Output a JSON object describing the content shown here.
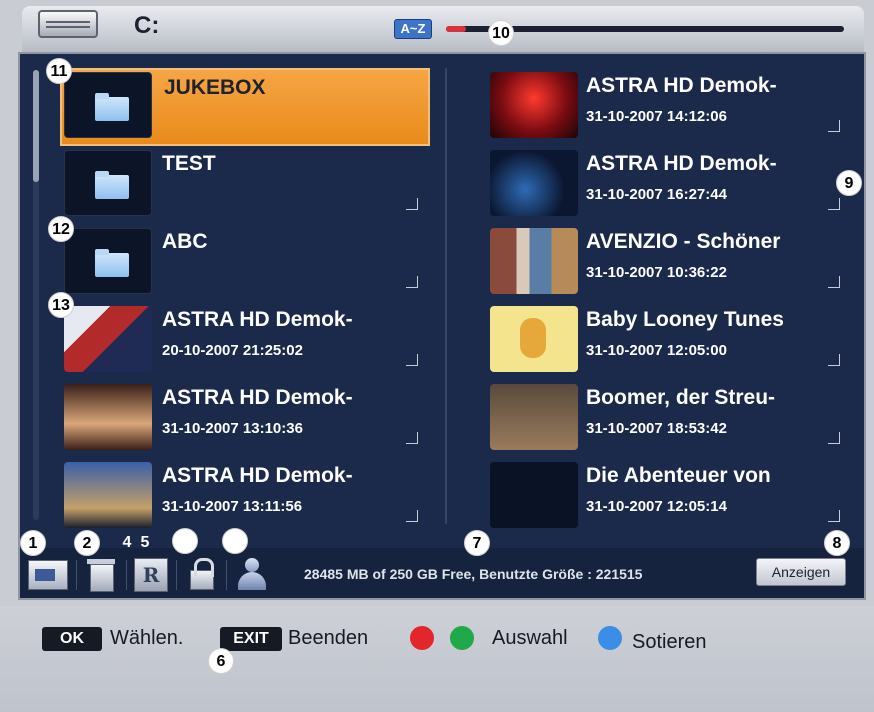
{
  "header": {
    "drive_label": "C:",
    "sort_badge": "A~Z",
    "progress_fraction": 0.05,
    "colors": {
      "progress": "#d9343a",
      "badge": "#3d74c7"
    }
  },
  "left_list": [
    {
      "title": "JUKEBOX",
      "date": "",
      "type": "folder",
      "selected": true,
      "checkbox": false
    },
    {
      "title": "TEST",
      "date": "",
      "type": "folder",
      "selected": false,
      "checkbox": true
    },
    {
      "title": "ABC",
      "date": "",
      "type": "folder",
      "selected": false,
      "checkbox": true
    },
    {
      "title": "ASTRA HD Demok-",
      "date": "20-10-2007 21:25:02",
      "type": "video",
      "selected": false,
      "checkbox": true
    },
    {
      "title": "ASTRA HD Demok-",
      "date": "31-10-2007 13:10:36",
      "type": "video",
      "selected": false,
      "checkbox": true
    },
    {
      "title": "ASTRA HD Demok-",
      "date": "31-10-2007 13:11:56",
      "type": "video",
      "selected": false,
      "checkbox": true
    }
  ],
  "right_list": [
    {
      "title": "ASTRA HD Demok-",
      "date": "31-10-2007 14:12:06",
      "type": "video",
      "checkbox": true
    },
    {
      "title": "ASTRA HD Demok-",
      "date": "31-10-2007 16:27:44",
      "type": "video",
      "checkbox": true
    },
    {
      "title": "AVENZIO - Schöner",
      "date": "31-10-2007 10:36:22",
      "type": "video",
      "checkbox": true
    },
    {
      "title": "Baby Looney Tunes",
      "date": "31-10-2007 12:05:00",
      "type": "video",
      "checkbox": true
    },
    {
      "title": "Boomer, der Streu-",
      "date": "31-10-2007 18:53:42",
      "type": "video",
      "checkbox": true
    },
    {
      "title": "Die Abenteuer von",
      "date": "31-10-2007 12:05:14",
      "type": "video",
      "checkbox": true
    }
  ],
  "toolbar": {
    "rename_glyph": "R",
    "icons": [
      "view-mode-icon",
      "trash-icon",
      "rename-icon",
      "lock-icon",
      "user-icon"
    ],
    "storage_text": "28485 MB of 250 GB Free, Benutzte Größe : 221515",
    "show_button": "Anzeigen"
  },
  "footer": {
    "ok_key": "OK",
    "ok_label": "Wählen.",
    "exit_key": "EXIT",
    "exit_label": "Beenden",
    "select_label": "Auswahl",
    "sort_label": "Sotieren",
    "colors": {
      "red": "#e1262c",
      "green": "#21a84a",
      "blue": "#3a8ee6"
    }
  },
  "callouts": {
    "c1": "1",
    "c2": "2",
    "c4": "4",
    "c5": "5",
    "c6": "6",
    "c7": "7",
    "c8": "8",
    "c9": "9",
    "c10": "10",
    "c11": "11",
    "c12": "12",
    "c13": "13"
  }
}
